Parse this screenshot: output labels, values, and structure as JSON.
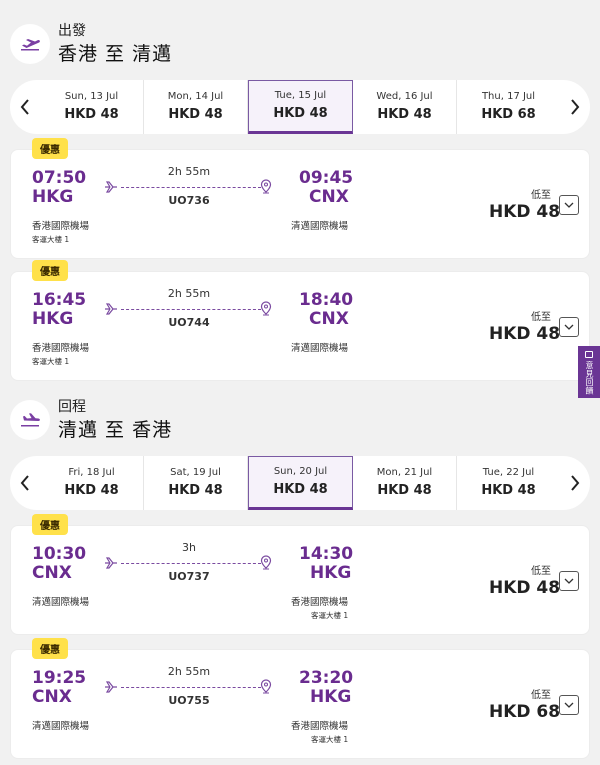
{
  "outbound": {
    "label": "出發",
    "route": "香港 至 清邁",
    "dates": [
      {
        "label": "Sun, 13 Jul",
        "price": "HKD 48"
      },
      {
        "label": "Mon, 14 Jul",
        "price": "HKD 48"
      },
      {
        "label": "Tue, 15 Jul",
        "price": "HKD 48",
        "selected": true
      },
      {
        "label": "Wed, 16 Jul",
        "price": "HKD 48"
      },
      {
        "label": "Thu, 17 Jul",
        "price": "HKD 68"
      }
    ],
    "flights": [
      {
        "badge": "優惠",
        "dep_time": "07:50",
        "dep_code": "HKG",
        "dep_airport": "香港國際機場",
        "dep_terminal": "客運大樓 1",
        "duration": "2h 55m",
        "flight_no": "UO736",
        "arr_time": "09:45",
        "arr_code": "CNX",
        "arr_airport": "清邁國際機場",
        "arr_terminal": "",
        "from_label": "低至",
        "price": "HKD 48"
      },
      {
        "badge": "優惠",
        "dep_time": "16:45",
        "dep_code": "HKG",
        "dep_airport": "香港國際機場",
        "dep_terminal": "客運大樓 1",
        "duration": "2h 55m",
        "flight_no": "UO744",
        "arr_time": "18:40",
        "arr_code": "CNX",
        "arr_airport": "清邁國際機場",
        "arr_terminal": "",
        "from_label": "低至",
        "price": "HKD 48"
      }
    ]
  },
  "inbound": {
    "label": "回程",
    "route": "清邁 至 香港",
    "dates": [
      {
        "label": "Fri, 18 Jul",
        "price": "HKD 48"
      },
      {
        "label": "Sat, 19 Jul",
        "price": "HKD 48"
      },
      {
        "label": "Sun, 20 Jul",
        "price": "HKD 48",
        "selected": true
      },
      {
        "label": "Mon, 21 Jul",
        "price": "HKD 48"
      },
      {
        "label": "Tue, 22 Jul",
        "price": "HKD 48"
      }
    ],
    "flights": [
      {
        "badge": "優惠",
        "dep_time": "10:30",
        "dep_code": "CNX",
        "dep_airport": "清邁國際機場",
        "dep_terminal": "",
        "duration": "3h",
        "flight_no": "UO737",
        "arr_time": "14:30",
        "arr_code": "HKG",
        "arr_airport": "香港國際機場",
        "arr_terminal": "客運大樓 1",
        "from_label": "低至",
        "price": "HKD 48"
      },
      {
        "badge": "優惠",
        "dep_time": "19:25",
        "dep_code": "CNX",
        "dep_airport": "清邁國際機場",
        "dep_terminal": "",
        "duration": "2h 55m",
        "flight_no": "UO755",
        "arr_time": "23:20",
        "arr_code": "HKG",
        "arr_airport": "香港國際機場",
        "arr_terminal": "客運大樓 1",
        "from_label": "低至",
        "price": "HKD 68"
      }
    ]
  },
  "feedback": {
    "label": "意見回饋"
  },
  "icons": {
    "takeoff": "plane-takeoff-icon",
    "landing": "plane-landing-icon",
    "pin": "location-pin-icon",
    "chevron": "chevron-down-icon"
  },
  "colors": {
    "brand": "#6a3594",
    "badge": "#ffe14a",
    "background": "#f1f1f1"
  }
}
